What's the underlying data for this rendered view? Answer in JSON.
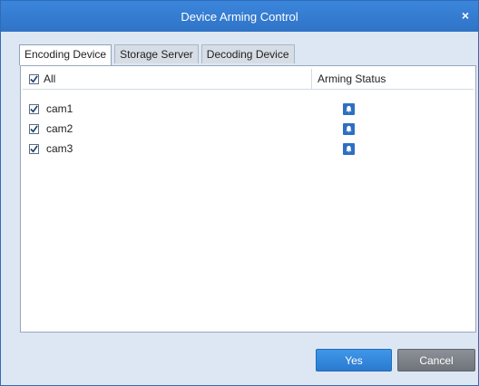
{
  "window": {
    "title": "Device Arming Control",
    "close_label": "×"
  },
  "tabs": [
    {
      "label": "Encoding Device",
      "active": true
    },
    {
      "label": "Storage Server",
      "active": false
    },
    {
      "label": "Decoding Device",
      "active": false
    }
  ],
  "table": {
    "headers": {
      "select_all": "All",
      "arming_status": "Arming Status"
    },
    "rows": [
      {
        "name": "cam1",
        "checked": true,
        "armed_icon": "bell-icon"
      },
      {
        "name": "cam2",
        "checked": true,
        "armed_icon": "bell-icon"
      },
      {
        "name": "cam3",
        "checked": true,
        "armed_icon": "bell-icon"
      }
    ]
  },
  "buttons": {
    "yes": "Yes",
    "cancel": "Cancel"
  },
  "colors": {
    "accent": "#2f73c6",
    "status_icon": "#2f6fc2"
  }
}
